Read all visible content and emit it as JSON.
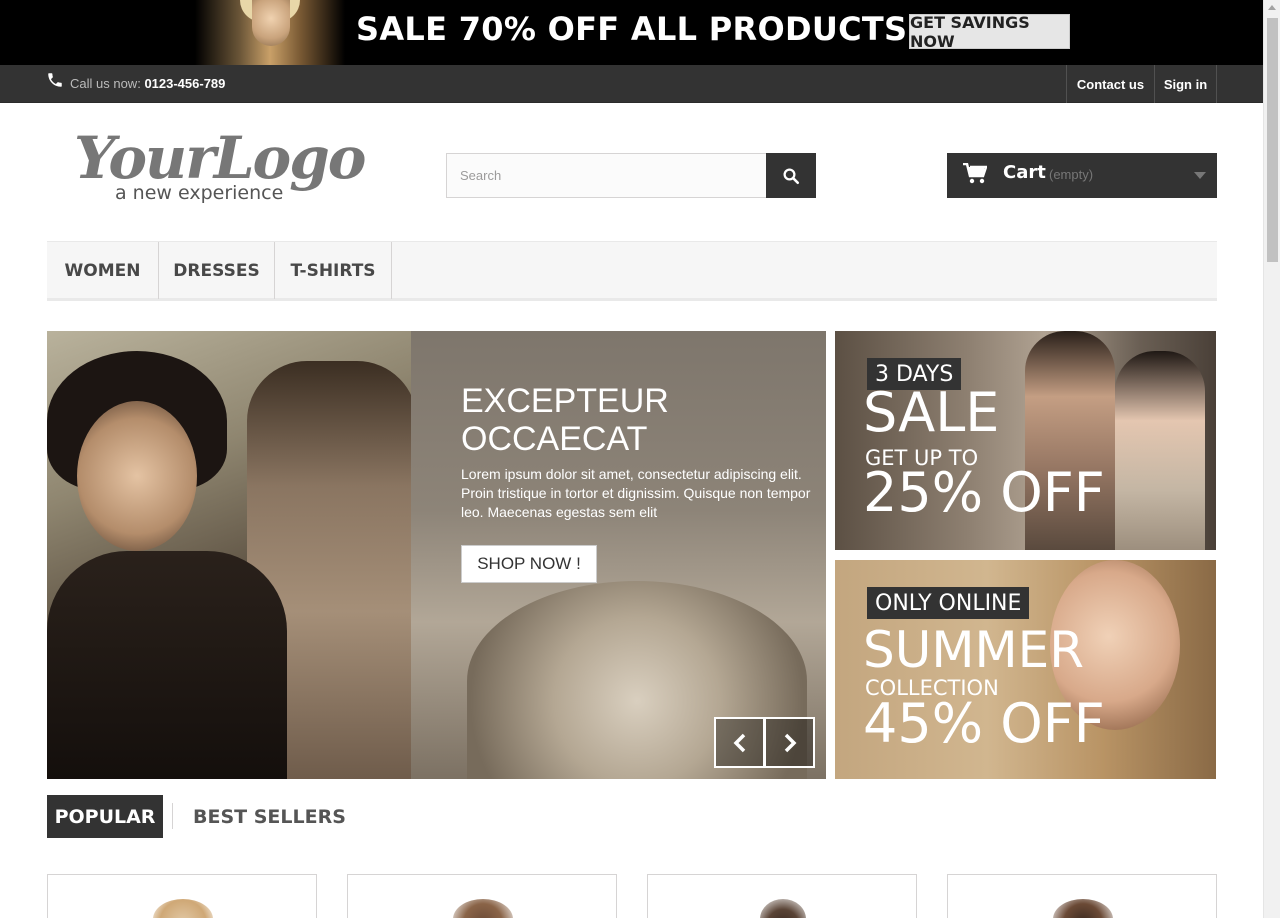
{
  "banner": {
    "headline": "SALE 70% OFF ALL PRODUCTS",
    "cta": "GET SAVINGS NOW"
  },
  "navbar": {
    "call_label": "Call us now:",
    "phone": "0123-456-789",
    "contact": "Contact us",
    "signin": "Sign in"
  },
  "logo": {
    "main": "YourLogo",
    "tagline": "a new experience"
  },
  "search": {
    "placeholder": "Search"
  },
  "cart": {
    "label": "Cart",
    "status": "(empty)"
  },
  "menu": {
    "items": [
      "WOMEN",
      "DRESSES",
      "T-SHIRTS"
    ]
  },
  "slider": {
    "title": "EXCEPTEUR OCCAECAT",
    "description": "Lorem ipsum dolor sit amet, consectetur adipiscing elit. Proin tristique in tortor et dignissim. Quisque non tempor leo. Maecenas egestas sem elit",
    "button": "SHOP NOW !"
  },
  "promos": [
    {
      "tag": "3 DAYS",
      "big": "SALE",
      "sub": "GET UP TO",
      "offer": "25% OFF"
    },
    {
      "tag": "ONLY ONLINE",
      "big": "SUMMER",
      "sub": "COLLECTION",
      "offer": "45% OFF"
    }
  ],
  "tabs": {
    "popular": "POPULAR",
    "best_sellers": "BEST SELLERS"
  },
  "colors": {
    "dark": "#333333",
    "banner_bg": "#000000",
    "menu_bg": "#f6f6f6",
    "text": "#484848"
  }
}
